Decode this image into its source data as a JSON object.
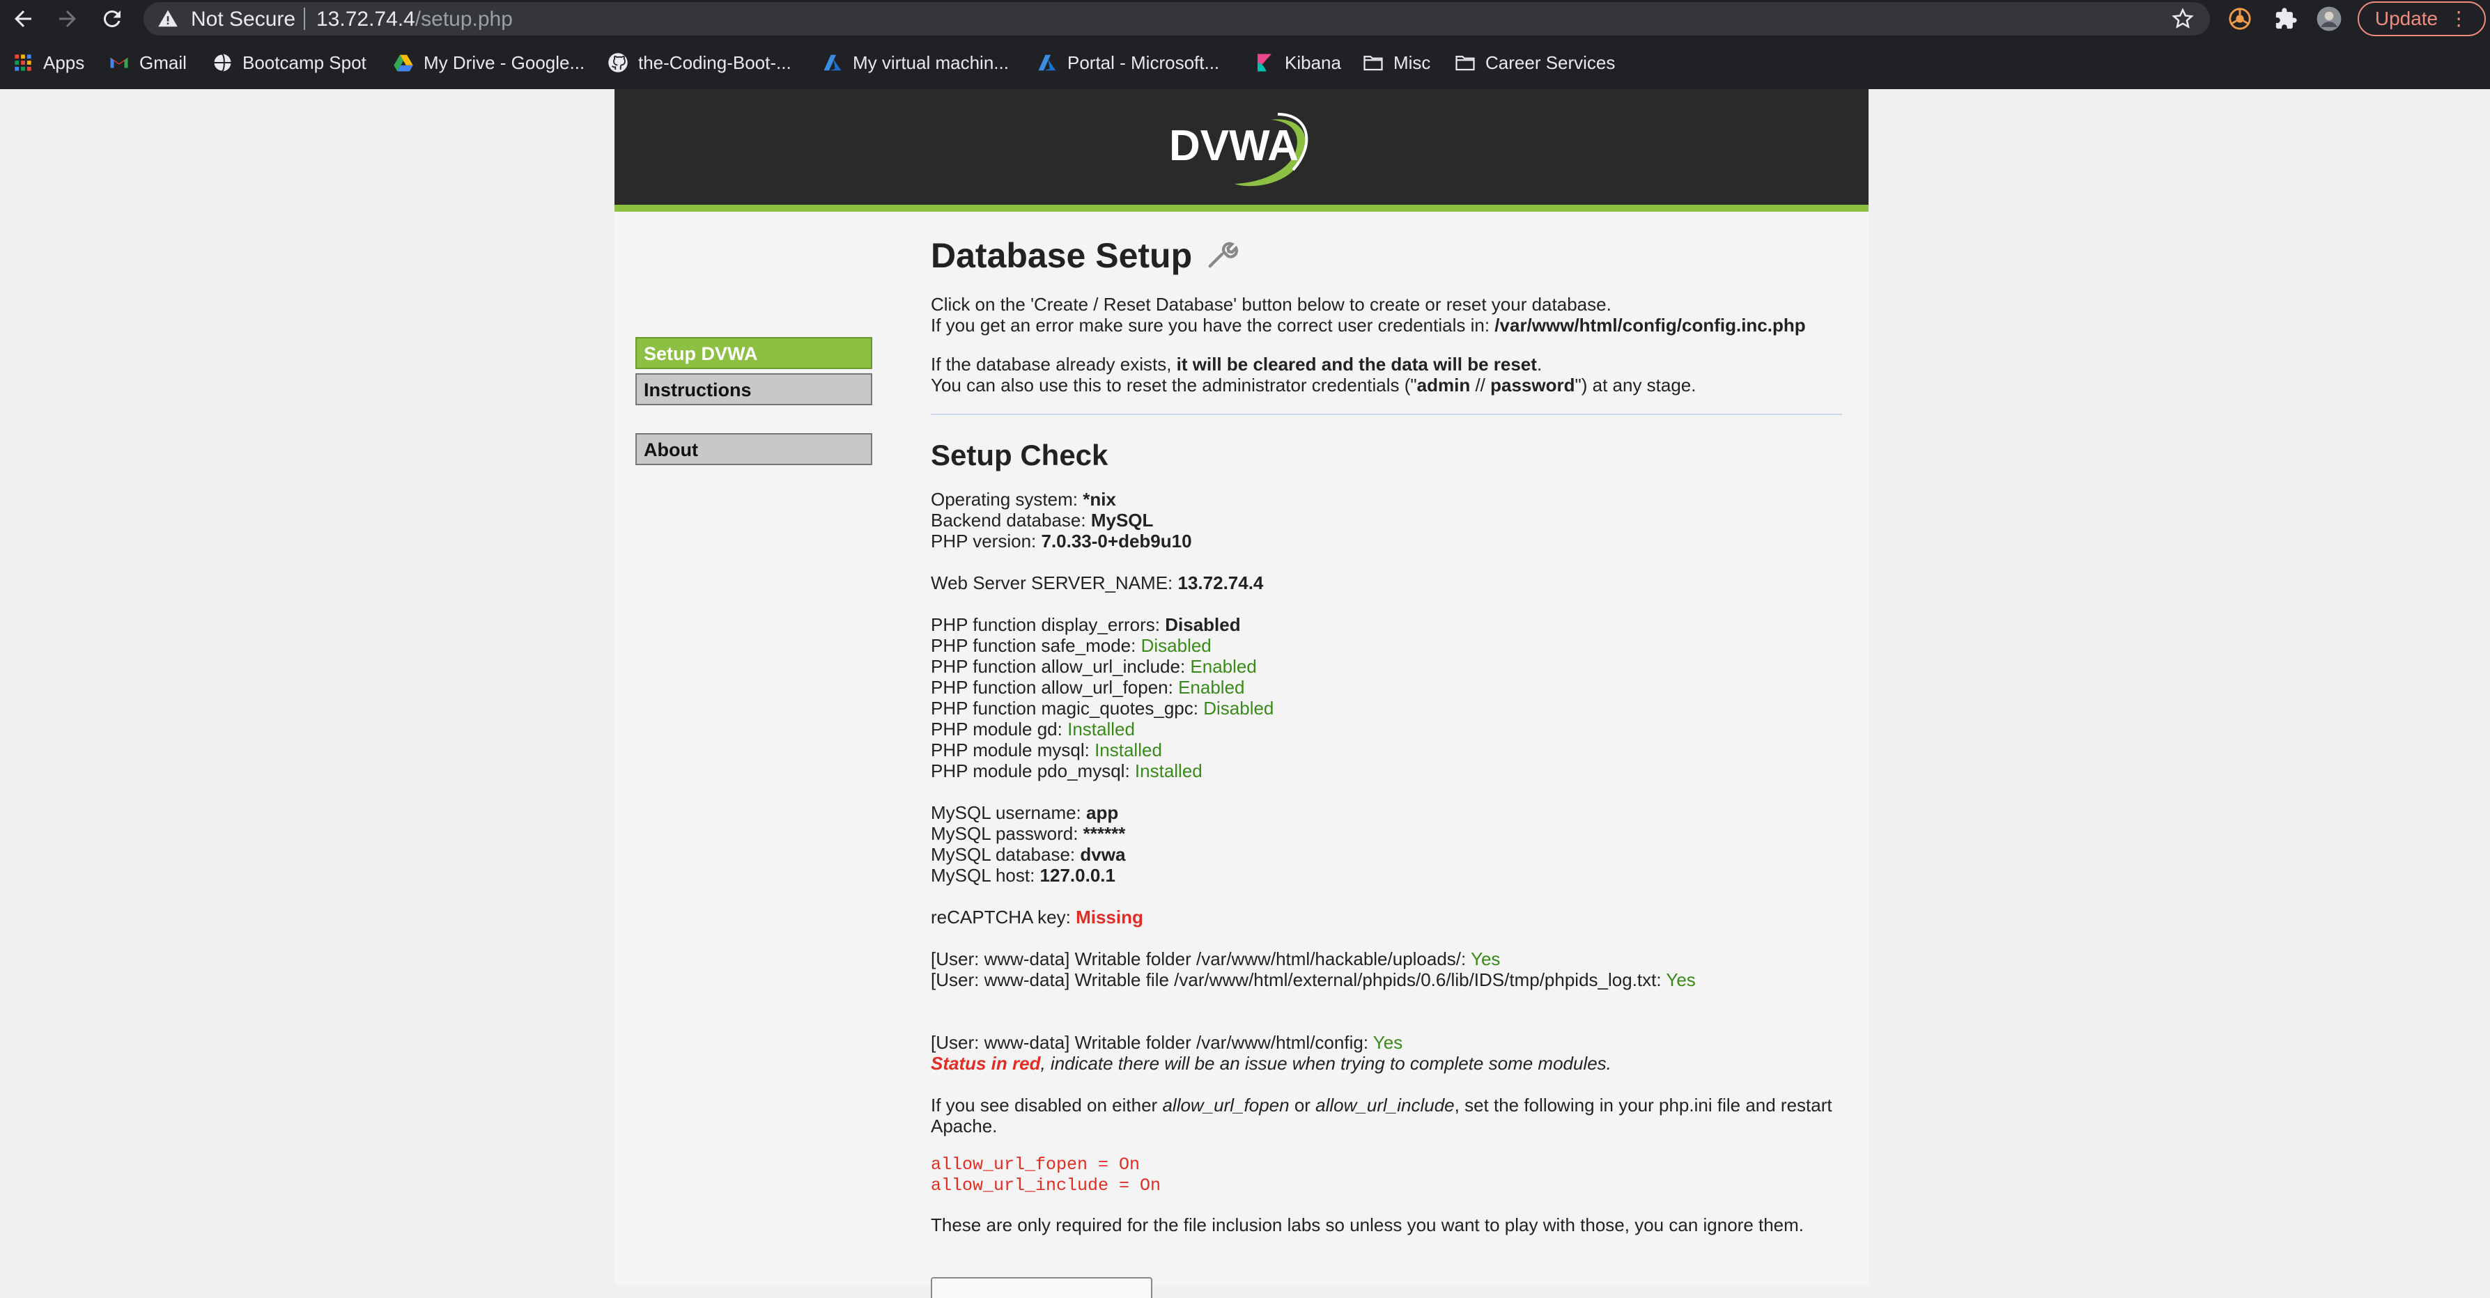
{
  "browser": {
    "security_label": "Not Secure",
    "url_host": "13.72.74.4",
    "url_path": "/setup.php",
    "update_label": "Update",
    "bookmarks": [
      {
        "label": "Apps",
        "icon": "apps-grid-icon"
      },
      {
        "label": "Gmail",
        "icon": "gmail-icon"
      },
      {
        "label": "Bootcamp Spot",
        "icon": "globe-icon"
      },
      {
        "label": "My Drive - Google...",
        "icon": "google-drive-icon"
      },
      {
        "label": "the-Coding-Boot-...",
        "icon": "github-icon"
      },
      {
        "label": "My virtual machin...",
        "icon": "azure-icon"
      },
      {
        "label": "Portal - Microsoft...",
        "icon": "azure-icon"
      },
      {
        "label": "Kibana",
        "icon": "kibana-icon"
      },
      {
        "label": "Misc",
        "icon": "folder-icon"
      },
      {
        "label": "Career Services",
        "icon": "folder-icon"
      }
    ]
  },
  "site": {
    "logo_text": "DVWA",
    "menu": [
      "Setup DVWA",
      "Instructions",
      "About"
    ],
    "accent_color": "#8dbf42"
  },
  "content": {
    "title": "Database Setup",
    "intro1": "Click on the 'Create / Reset Database' button below to create or reset your database.",
    "intro2_pre": "If you get an error make sure you have the correct user credentials in: ",
    "intro2_path": "/var/www/html/config/config.inc.php",
    "intro3_pre": "If the database already exists, ",
    "intro3_bold": "it will be cleared and the data will be reset",
    "intro3_post": ".",
    "intro4_pre": "You can also use this to reset the administrator credentials (\"",
    "intro4_user": "admin",
    "intro4_mid": " // ",
    "intro4_pass": "password",
    "intro4_post": "\") at any stage.",
    "check_title": "Setup Check",
    "os_label": "Operating system: ",
    "os_value": "*nix",
    "db_label": "Backend database: ",
    "db_value": "MySQL",
    "php_label": "PHP version: ",
    "php_value": "7.0.33-0+deb9u10",
    "server_label": "Web Server SERVER_NAME: ",
    "server_value": "13.72.74.4",
    "functions": [
      {
        "label": "PHP function display_errors: ",
        "value": "Disabled"
      },
      {
        "label": "PHP function safe_mode: ",
        "value": "Disabled"
      },
      {
        "label": "PHP function allow_url_include: ",
        "value": "Enabled"
      },
      {
        "label": "PHP function allow_url_fopen: ",
        "value": "Enabled"
      },
      {
        "label": "PHP function magic_quotes_gpc: ",
        "value": "Disabled"
      },
      {
        "label": "PHP module gd: ",
        "value": "Installed"
      },
      {
        "label": "PHP module mysql: ",
        "value": "Installed"
      },
      {
        "label": "PHP module pdo_mysql: ",
        "value": "Installed"
      }
    ],
    "mysql": [
      {
        "label": "MySQL username: ",
        "value": "app"
      },
      {
        "label": "MySQL password: ",
        "value": "******"
      },
      {
        "label": "MySQL database: ",
        "value": "dvwa"
      },
      {
        "label": "MySQL host: ",
        "value": "127.0.0.1"
      }
    ],
    "recaptcha_label": "reCAPTCHA key: ",
    "recaptcha_value": "Missing",
    "writable1_label": "[User: www-data] Writable folder /var/www/html/hackable/uploads/: ",
    "writable1_value": "Yes",
    "writable2_label": "[User: www-data] Writable file /var/www/html/external/phpids/0.6/lib/IDS/tmp/phpids_log.txt: ",
    "writable2_value": "Yes",
    "writable3_label": "[User: www-data] Writable folder /var/www/html/config: ",
    "writable3_value": "Yes",
    "status_red": "Status in red",
    "status_rest": ", indicate there will be an issue when trying to complete some modules.",
    "disabled_pre": "If you see disabled on either ",
    "disabled_fopen": "allow_url_fopen",
    "disabled_or": " or ",
    "disabled_include": "allow_url_include",
    "disabled_post": ", set the following in your php.ini file and restart",
    "disabled_line2": "Apache.",
    "code1": "allow_url_fopen = On",
    "code2": "allow_url_include = On",
    "footer_note": "These are only required for the file inclusion labs so unless you want to play with those, you can ignore them."
  }
}
